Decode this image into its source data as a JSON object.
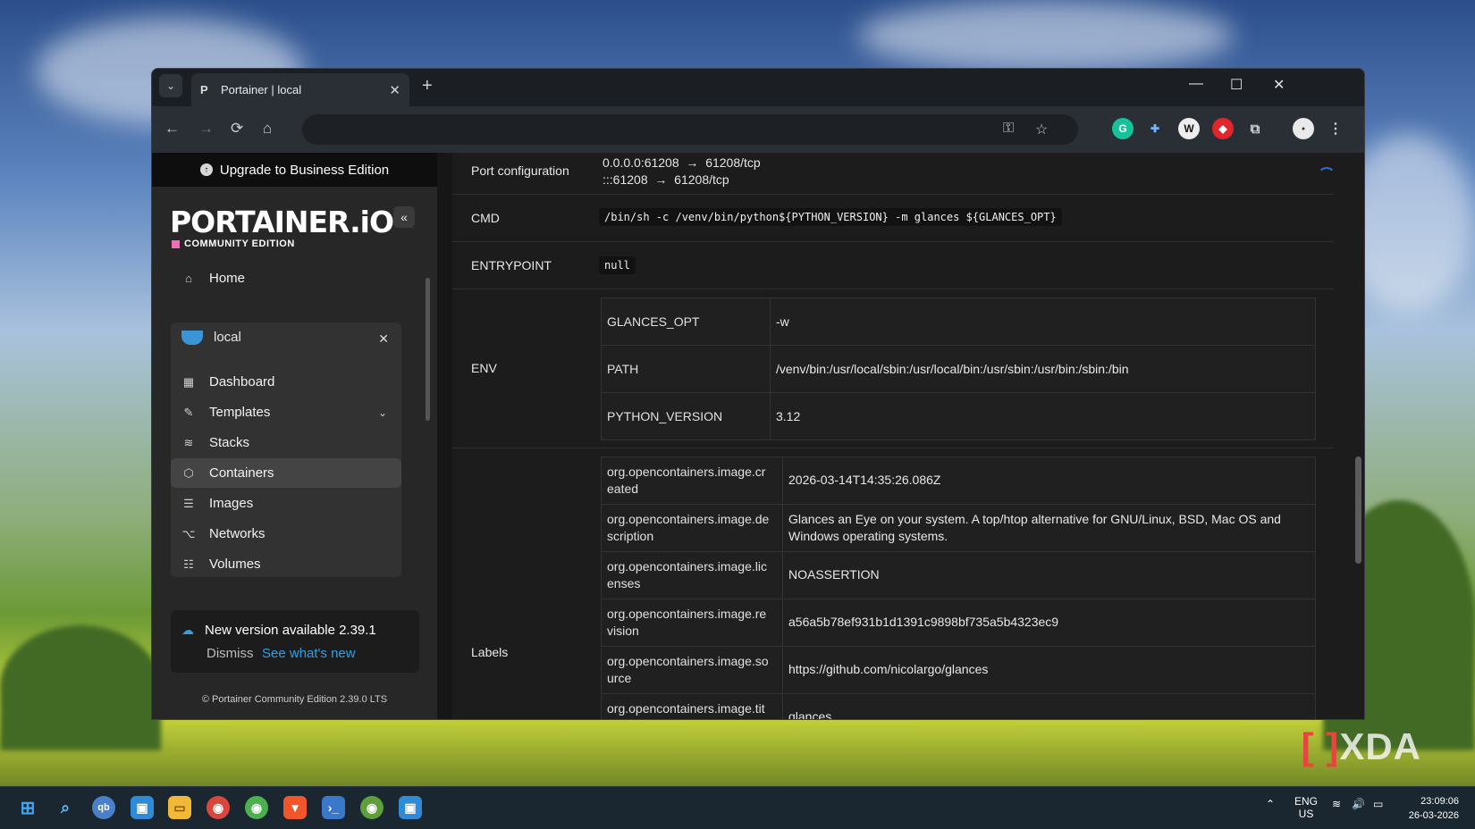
{
  "browser": {
    "tab_title": "Portainer | local",
    "new_tab": "+",
    "minimize": "—",
    "maximize": "☐",
    "close": "✕",
    "nav": {
      "back": "←",
      "forward": "→",
      "reload": "⟳",
      "home": "⌂"
    }
  },
  "sidebar": {
    "upgrade": "Upgrade to Business Edition",
    "logo": "PORTAINER.iO",
    "edition": "COMMUNITY EDITION",
    "home": "Home",
    "environment": "local",
    "items": [
      {
        "label": "Dashboard",
        "icon": "dashboard-icon"
      },
      {
        "label": "Templates",
        "icon": "edit-icon"
      },
      {
        "label": "Stacks",
        "icon": "layers-icon"
      },
      {
        "label": "Containers",
        "icon": "box-icon"
      },
      {
        "label": "Images",
        "icon": "list-icon"
      },
      {
        "label": "Networks",
        "icon": "network-icon"
      },
      {
        "label": "Volumes",
        "icon": "database-icon"
      }
    ],
    "notice": {
      "title": "New version available 2.39.1",
      "dismiss": "Dismiss",
      "whats_new": "See what's new"
    },
    "footer": "© Portainer Community Edition 2.39.0 LTS"
  },
  "details": {
    "port_label": "Port configuration",
    "ports": [
      {
        "host": "0.0.0.0:61208",
        "container": "61208/tcp"
      },
      {
        "host": ":::61208",
        "container": "61208/tcp"
      }
    ],
    "cmd_label": "CMD",
    "cmd": "/bin/sh -c /venv/bin/python${PYTHON_VERSION} -m glances ${GLANCES_OPT}",
    "entrypoint_label": "ENTRYPOINT",
    "entrypoint": "null",
    "env_label": "ENV",
    "env": [
      {
        "key": "GLANCES_OPT",
        "value": "-w"
      },
      {
        "key": "PATH",
        "value": "/venv/bin:/usr/local/sbin:/usr/local/bin:/usr/sbin:/usr/bin:/sbin:/bin"
      },
      {
        "key": "PYTHON_VERSION",
        "value": "3.12"
      }
    ],
    "labels_label": "Labels",
    "labels": [
      {
        "key1": "org.opencontainers.image.cr",
        "key2": "eated",
        "value1": "2026-03-14T14:35:26.086Z",
        "value2": ""
      },
      {
        "key1": "org.opencontainers.image.de",
        "key2": "scription",
        "value1": "Glances an Eye on your system. A top/htop alternative for GNU/Linux, BSD, Mac OS and",
        "value2": "Windows operating systems."
      },
      {
        "key1": "org.opencontainers.image.lic",
        "key2": "enses",
        "value1": "NOASSERTION",
        "value2": ""
      },
      {
        "key1": "org.opencontainers.image.re",
        "key2": "vision",
        "value1": "a56a5b78ef931b1d1391c9898bf735a5b4323ec9",
        "value2": ""
      },
      {
        "key1": "org.opencontainers.image.so",
        "key2": "urce",
        "value1": "https://github.com/nicolargo/glances",
        "value2": ""
      },
      {
        "key1": "org.opencontainers.image.tit",
        "key2": "",
        "value1": "glances",
        "value2": ""
      }
    ]
  },
  "taskbar": {
    "lang1": "ENG",
    "lang2": "US",
    "time": "23:09:06",
    "date": "26-03-2026"
  },
  "watermark": "XDA",
  "colors": {
    "accent": "#2ea0e6",
    "brand_pink": "#ee6fb4"
  }
}
